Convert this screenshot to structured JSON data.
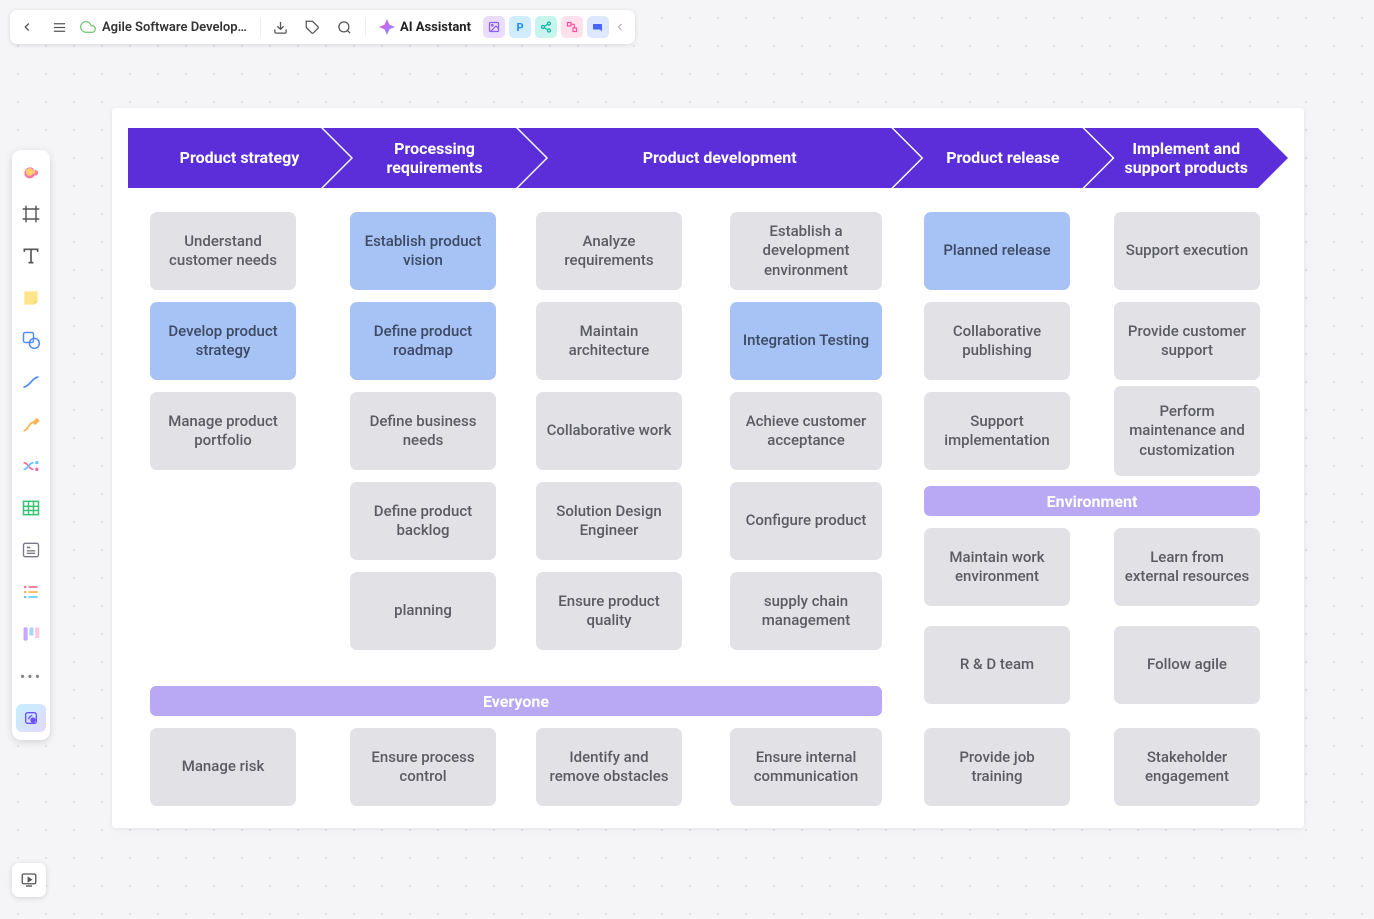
{
  "topbar": {
    "doc_title": "Agile Software Develop…",
    "ai_label": "AI Assistant"
  },
  "phases": {
    "p0": "Product strategy",
    "p1": "Processing requirements",
    "p2": "Product development",
    "p3": "Product release",
    "p4": "Implement and support products"
  },
  "bands": {
    "everyone": "Everyone",
    "environment": "Environment"
  },
  "cards": {
    "c1": "Understand customer needs",
    "c2": "Develop product strategy",
    "c3": "Manage product portfolio",
    "c4": "Establish product vision",
    "c5": "Define product roadmap",
    "c6": "Define business needs",
    "c7": "Define product backlog",
    "c8": "planning",
    "c9": "Analyze requirements",
    "c10": "Maintain architecture",
    "c11": "Collaborative work",
    "c12": "Solution Design Engineer",
    "c13": "Ensure product quality",
    "c14": "Establish a development environment",
    "c15": "Integration Testing",
    "c16": "Achieve customer acceptance",
    "c17": "Configure product",
    "c18": "supply chain management",
    "c19": "Planned release",
    "c20": "Collaborative publishing",
    "c21": "Support implementation",
    "c22": "Support execution",
    "c23": "Provide customer support",
    "c24": "Perform maintenance and customization",
    "c25": "Maintain work environment",
    "c26": "Learn from external resources",
    "c27": "R & D team",
    "c28": "Follow agile",
    "c29": "Manage risk",
    "c30": "Ensure process control",
    "c31": "Identify and remove obstacles",
    "c32": "Ensure internal communication",
    "c33": "Provide job training",
    "c34": "Stakeholder engagement"
  }
}
